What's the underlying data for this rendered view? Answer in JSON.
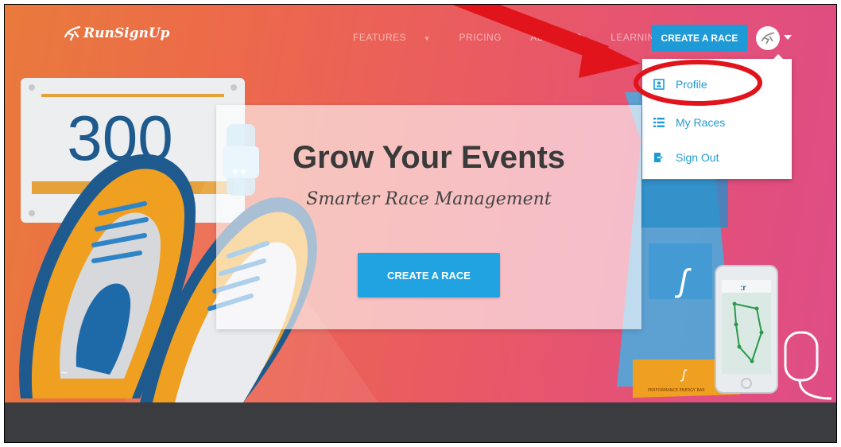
{
  "nav": {
    "logo_text": "RunSignUp",
    "items": [
      {
        "label": "FEATURES",
        "has_caret": true
      },
      {
        "label": "PRICING",
        "has_caret": false
      },
      {
        "label": "ABOUT US",
        "has_caret": false
      },
      {
        "label": "LEARNING",
        "has_caret": true
      }
    ],
    "create_race_label": "CREATE A RACE"
  },
  "dropdown": {
    "items": [
      {
        "label": "Profile",
        "icon": "profile-card-icon"
      },
      {
        "label": "My Races",
        "icon": "list-icon"
      },
      {
        "label": "Sign Out",
        "icon": "sign-out-icon"
      }
    ]
  },
  "hero": {
    "title": "Grow Your Events",
    "subtitle": "Smarter Race Management",
    "cta_label": "CREATE A RACE",
    "bib_number": "300",
    "energy_bar_label": "PERFORMANCE ENERGY BAR"
  },
  "annotation": {
    "color": "#e0141a"
  },
  "colors": {
    "accent_blue": "#1e9ad6",
    "footer": "#3a3c3f"
  }
}
